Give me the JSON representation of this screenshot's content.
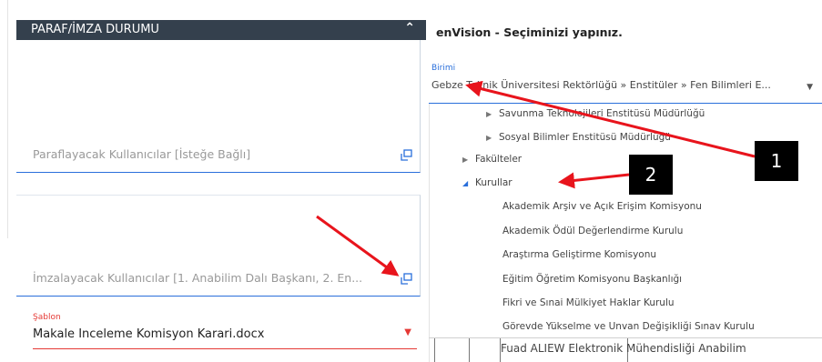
{
  "left_panel": {
    "header_title": "PARAF/İMZA DURUMU",
    "collapse_icon": "chevron-up-icon",
    "paraflayacak_label": "Paraflayacak Kullanıcılar [İsteğe Bağlı]",
    "imzalayacak_label": "İmzalayacak Kullanıcılar [1. Anabilim Dalı Başkanı, 2. En...",
    "sablon_label": "Şablon",
    "sablon_value": "Makale Inceleme Komisyon Karari.docx"
  },
  "dialog": {
    "title": "enVision - Seçiminizi yapınız.",
    "birimi_label": "Birimi",
    "birimi_value": "Gebze Teknik Üniversitesi Rektörlüğü » Enstitüler » Fen Bilimleri E...",
    "tree": {
      "savunma": "Savunma Teknolojileri Enstitüsü Müdürlüğü",
      "sosyal": "Sosyal Bilimler Enstitüsü Müdürlüğü",
      "fakulteler": "Fakülteler",
      "kurullar": "Kurullar",
      "children": [
        "Akademik Arşiv ve Açık Erişim Komisyonu",
        "Akademik Ödül Değerlendirme Kurulu",
        "Araştırma Geliştirme Komisyonu",
        "Eğitim Öğretim Komisyonu Başkanlığı",
        "Fikri ve Sınai Mülkiyet Haklar Kurulu",
        "Görevde Yükselme ve Unvan Değişikliği Sınav Kurulu"
      ]
    }
  },
  "background": {
    "row_text": "Fuad ALIEW  Elektronik Mühendisliği Anabilim"
  },
  "callouts": {
    "one": "1",
    "two": "2"
  },
  "colors": {
    "header_bg": "#34404d",
    "accent_blue": "#2a6fdb",
    "required_red": "#e53935",
    "arrow_red": "#e8141c"
  }
}
